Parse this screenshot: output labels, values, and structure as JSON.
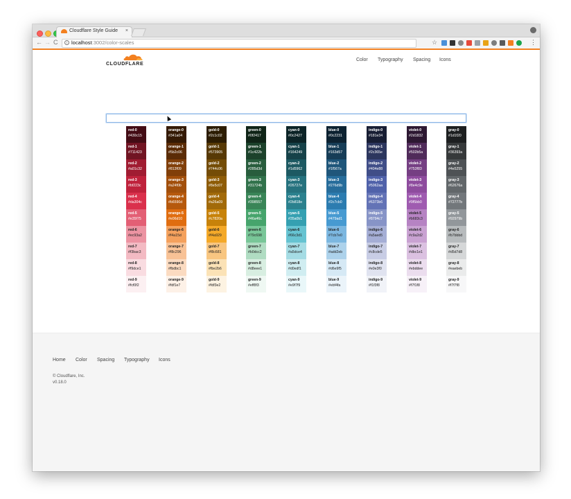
{
  "browser": {
    "tab_title": "Cloudflare Style Guide",
    "tab_close": "×",
    "url_host": "localhost",
    "url_path": ":3002/color-scales",
    "back": "←",
    "forward": "→",
    "reload": "C",
    "star": "☆",
    "menu": "⋮"
  },
  "header": {
    "logo_text": "CLOUDFLARE",
    "nav": [
      "Color",
      "Typography",
      "Spacing",
      "Icons"
    ]
  },
  "search": {
    "value": ""
  },
  "scales": [
    {
      "name": "red",
      "swatches": [
        {
          "name": "red-0",
          "hex": "#430c15"
        },
        {
          "name": "red-1",
          "hex": "#711423"
        },
        {
          "name": "red-2",
          "hex": "#a01c32"
        },
        {
          "name": "red-3",
          "hex": "#bf223c"
        },
        {
          "name": "red-4",
          "hex": "#da304c"
        },
        {
          "name": "red-5",
          "hex": "#e35f75"
        },
        {
          "name": "red-6",
          "hex": "#ec93a2"
        },
        {
          "name": "red-7",
          "hex": "#f3bac3"
        },
        {
          "name": "red-8",
          "hex": "#f9dce1"
        },
        {
          "name": "red-9",
          "hex": "#fcf0f2"
        }
      ]
    },
    {
      "name": "orange",
      "swatches": [
        {
          "name": "orange-0",
          "hex": "#341a04"
        },
        {
          "name": "orange-1",
          "hex": "#5b2c06"
        },
        {
          "name": "orange-2",
          "hex": "#813f09"
        },
        {
          "name": "orange-3",
          "hex": "#a24f0b"
        },
        {
          "name": "orange-4",
          "hex": "#b6590d"
        },
        {
          "name": "orange-5",
          "hex": "#e06d10"
        },
        {
          "name": "orange-6",
          "hex": "#f4a15d"
        },
        {
          "name": "orange-7",
          "hex": "#f8c296"
        },
        {
          "name": "orange-8",
          "hex": "#fbdbc1"
        },
        {
          "name": "orange-9",
          "hex": "#fdf1e7"
        }
      ]
    },
    {
      "name": "gold",
      "swatches": [
        {
          "name": "gold-0",
          "hex": "#2c1c02"
        },
        {
          "name": "gold-1",
          "hex": "#573905"
        },
        {
          "name": "gold-2",
          "hex": "#744c06"
        },
        {
          "name": "gold-3",
          "hex": "#8e5c07"
        },
        {
          "name": "gold-4",
          "hex": "#a26a09"
        },
        {
          "name": "gold-5",
          "hex": "#c7820a"
        },
        {
          "name": "gold-6",
          "hex": "#f4a929"
        },
        {
          "name": "gold-7",
          "hex": "#f8c681"
        },
        {
          "name": "gold-8",
          "hex": "#fbe2b6"
        },
        {
          "name": "gold-9",
          "hex": "#fdf3e2"
        }
      ]
    },
    {
      "name": "green",
      "swatches": [
        {
          "name": "green-0",
          "hex": "#0f2417"
        },
        {
          "name": "green-1",
          "hex": "#1c422b"
        },
        {
          "name": "green-2",
          "hex": "#285d3d"
        },
        {
          "name": "green-3",
          "hex": "#31724b"
        },
        {
          "name": "green-4",
          "hex": "#398557"
        },
        {
          "name": "green-5",
          "hex": "#46a46c"
        },
        {
          "name": "green-6",
          "hex": "#79c698"
        },
        {
          "name": "green-7",
          "hex": "#b0dcc2"
        },
        {
          "name": "green-8",
          "hex": "#d8eee1"
        },
        {
          "name": "green-9",
          "hex": "#eff8f3"
        }
      ]
    },
    {
      "name": "cyan",
      "swatches": [
        {
          "name": "cyan-0",
          "hex": "#0c2427"
        },
        {
          "name": "cyan-1",
          "hex": "#164249"
        },
        {
          "name": "cyan-2",
          "hex": "#1d5962"
        },
        {
          "name": "cyan-3",
          "hex": "#26727e"
        },
        {
          "name": "cyan-4",
          "hex": "#2b818e"
        },
        {
          "name": "cyan-5",
          "hex": "#35a0b1"
        },
        {
          "name": "cyan-6",
          "hex": "#66c3d1"
        },
        {
          "name": "cyan-7",
          "hex": "#a5dce4"
        },
        {
          "name": "cyan-8",
          "hex": "#d0edf1"
        },
        {
          "name": "cyan-9",
          "hex": "#e9f7f9"
        }
      ]
    },
    {
      "name": "blue",
      "swatches": [
        {
          "name": "blue-0",
          "hex": "#0c2231"
        },
        {
          "name": "blue-1",
          "hex": "#163d57"
        },
        {
          "name": "blue-2",
          "hex": "#1f567a"
        },
        {
          "name": "blue-3",
          "hex": "#276d9b"
        },
        {
          "name": "blue-4",
          "hex": "#2c7cb0"
        },
        {
          "name": "blue-5",
          "hex": "#479ad1"
        },
        {
          "name": "blue-6",
          "hex": "#7cb7e0"
        },
        {
          "name": "blue-7",
          "hex": "#add2eb"
        },
        {
          "name": "blue-8",
          "hex": "#d6e9f5"
        },
        {
          "name": "blue-9",
          "hex": "#ebf4fa"
        }
      ]
    },
    {
      "name": "indigo",
      "swatches": [
        {
          "name": "indigo-0",
          "hex": "#181e34"
        },
        {
          "name": "indigo-1",
          "hex": "#2c365e"
        },
        {
          "name": "indigo-2",
          "hex": "#404e88"
        },
        {
          "name": "indigo-3",
          "hex": "#5062aa"
        },
        {
          "name": "indigo-4",
          "hex": "#6373b6"
        },
        {
          "name": "indigo-5",
          "hex": "#8794c7"
        },
        {
          "name": "indigo-6",
          "hex": "#a5aed5"
        },
        {
          "name": "indigo-7",
          "hex": "#c8cde5"
        },
        {
          "name": "indigo-8",
          "hex": "#e0e3f0"
        },
        {
          "name": "indigo-9",
          "hex": "#f1f3f8"
        }
      ]
    },
    {
      "name": "violet",
      "swatches": [
        {
          "name": "violet-0",
          "hex": "#2d1832"
        },
        {
          "name": "violet-1",
          "hex": "#502b5a"
        },
        {
          "name": "violet-2",
          "hex": "#753f83"
        },
        {
          "name": "violet-3",
          "hex": "#8e4c9e"
        },
        {
          "name": "violet-4",
          "hex": "#9f5bb0"
        },
        {
          "name": "violet-5",
          "hex": "#b683c3"
        },
        {
          "name": "violet-6",
          "hex": "#c9a2d2"
        },
        {
          "name": "violet-7",
          "hex": "#dbc1e1"
        },
        {
          "name": "violet-8",
          "hex": "#ebddee"
        },
        {
          "name": "violet-9",
          "hex": "#f7f1f8"
        }
      ]
    },
    {
      "name": "gray",
      "swatches": [
        {
          "name": "gray-0",
          "hex": "#1d1f20"
        },
        {
          "name": "gray-1",
          "hex": "#36393a"
        },
        {
          "name": "gray-2",
          "hex": "#4e5255"
        },
        {
          "name": "gray-3",
          "hex": "#62676a"
        },
        {
          "name": "gray-4",
          "hex": "#72777b"
        },
        {
          "name": "gray-5",
          "hex": "#92979b"
        },
        {
          "name": "gray-6",
          "hex": "#b7bbbd"
        },
        {
          "name": "gray-7",
          "hex": "#d5d7d8"
        },
        {
          "name": "gray-8",
          "hex": "#eaebeb"
        },
        {
          "name": "gray-9",
          "hex": "#f7f7f8"
        }
      ]
    }
  ],
  "footer": {
    "links": [
      "Home",
      "Color",
      "Spacing",
      "Typography",
      "Icons"
    ],
    "copyright": "© Cloudflare, Inc.",
    "version": "v0.18.0"
  },
  "colors": {
    "accent": "#f38020",
    "footer_bg": "#f5f5f5"
  }
}
